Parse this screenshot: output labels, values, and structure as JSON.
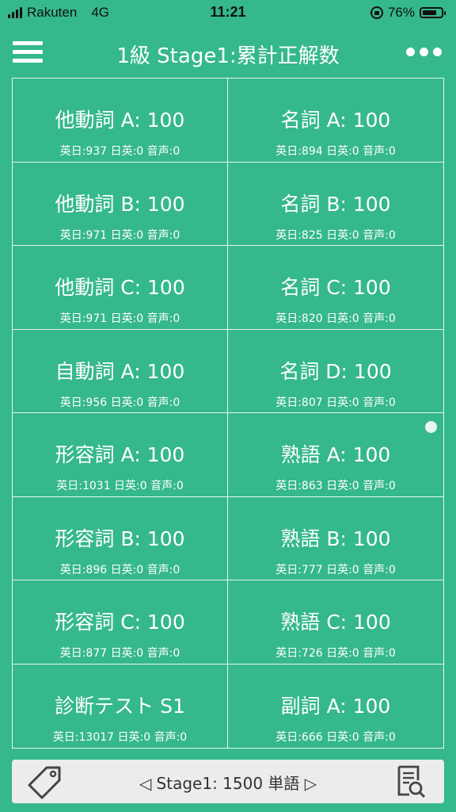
{
  "status": {
    "carrier": "Rakuten",
    "network": "4G",
    "time": "11:21",
    "battery": "76%",
    "battery_level": 0.76
  },
  "header": {
    "title": "1級 Stage1:累計正解数"
  },
  "cells": [
    {
      "title": "他動詞 A: 100",
      "sub": "英日:937 日英:0 音声:0"
    },
    {
      "title": "名詞 A: 100",
      "sub": "英日:894 日英:0 音声:0"
    },
    {
      "title": "他動詞 B: 100",
      "sub": "英日:971 日英:0 音声:0"
    },
    {
      "title": "名詞 B: 100",
      "sub": "英日:825 日英:0 音声:0"
    },
    {
      "title": "他動詞 C: 100",
      "sub": "英日:971 日英:0 音声:0"
    },
    {
      "title": "名詞 C: 100",
      "sub": "英日:820 日英:0 音声:0"
    },
    {
      "title": "自動詞 A: 100",
      "sub": "英日:956 日英:0 音声:0"
    },
    {
      "title": "名詞 D: 100",
      "sub": "英日:807 日英:0 音声:0"
    },
    {
      "title": "形容詞 A: 100",
      "sub": "英日:1031 日英:0 音声:0"
    },
    {
      "title": "熟語 A: 100",
      "sub": "英日:863 日英:0 音声:0"
    },
    {
      "title": "形容詞 B: 100",
      "sub": "英日:896 日英:0 音声:0"
    },
    {
      "title": "熟語 B: 100",
      "sub": "英日:777 日英:0 音声:0"
    },
    {
      "title": "形容詞 C: 100",
      "sub": "英日:877 日英:0 音声:0"
    },
    {
      "title": "熟語 C: 100",
      "sub": "英日:726 日英:0 音声:0"
    },
    {
      "title": "診断テスト S1",
      "sub": "英日:13017 日英:0 音声:0"
    },
    {
      "title": "副詞 A: 100",
      "sub": "英日:666 日英:0 音声:0"
    }
  ],
  "footer": {
    "label": "◁ Stage1: 1500 単語 ▷"
  },
  "icons": {
    "menu": "hamburger-menu-icon",
    "more": "more-dots-icon",
    "tag": "tag-icon",
    "doc_search": "document-search-icon"
  },
  "colors": {
    "background": "#35b88c",
    "text": "#ffffff",
    "footer_bg": "#ececec"
  }
}
